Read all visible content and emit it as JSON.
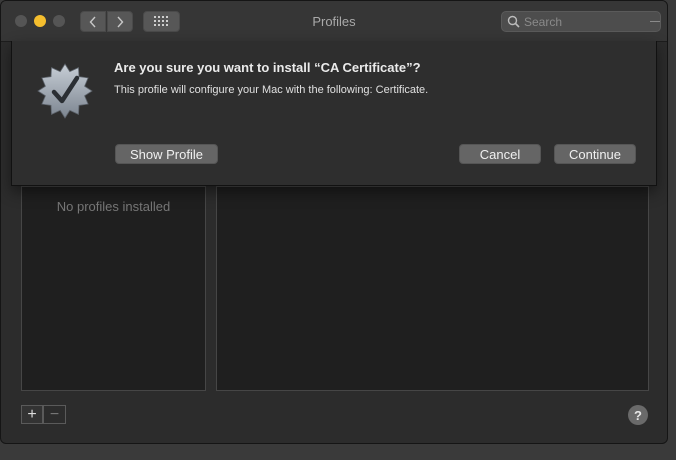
{
  "window": {
    "title": "Profiles",
    "search_placeholder": "Search"
  },
  "profiles_list": {
    "empty_text": "No profiles installed"
  },
  "footer": {
    "add_label": "+",
    "remove_label": "−",
    "help_label": "?"
  },
  "sheet": {
    "heading": "Are you sure you want to install “CA Certificate”?",
    "message": "This profile will configure your Mac with the following: Certificate.",
    "show_profile_label": "Show Profile",
    "cancel_label": "Cancel",
    "continue_label": "Continue"
  },
  "colors": {
    "minimize_dot": "#f5be2e",
    "window_bg": "#2c2c2c",
    "panel_bg": "#1f1f1f",
    "button_bg": "#656565"
  },
  "icons": [
    "back-chevron-icon",
    "forward-chevron-icon",
    "grid-icon",
    "search-icon",
    "verified-badge-icon",
    "help-icon"
  ]
}
